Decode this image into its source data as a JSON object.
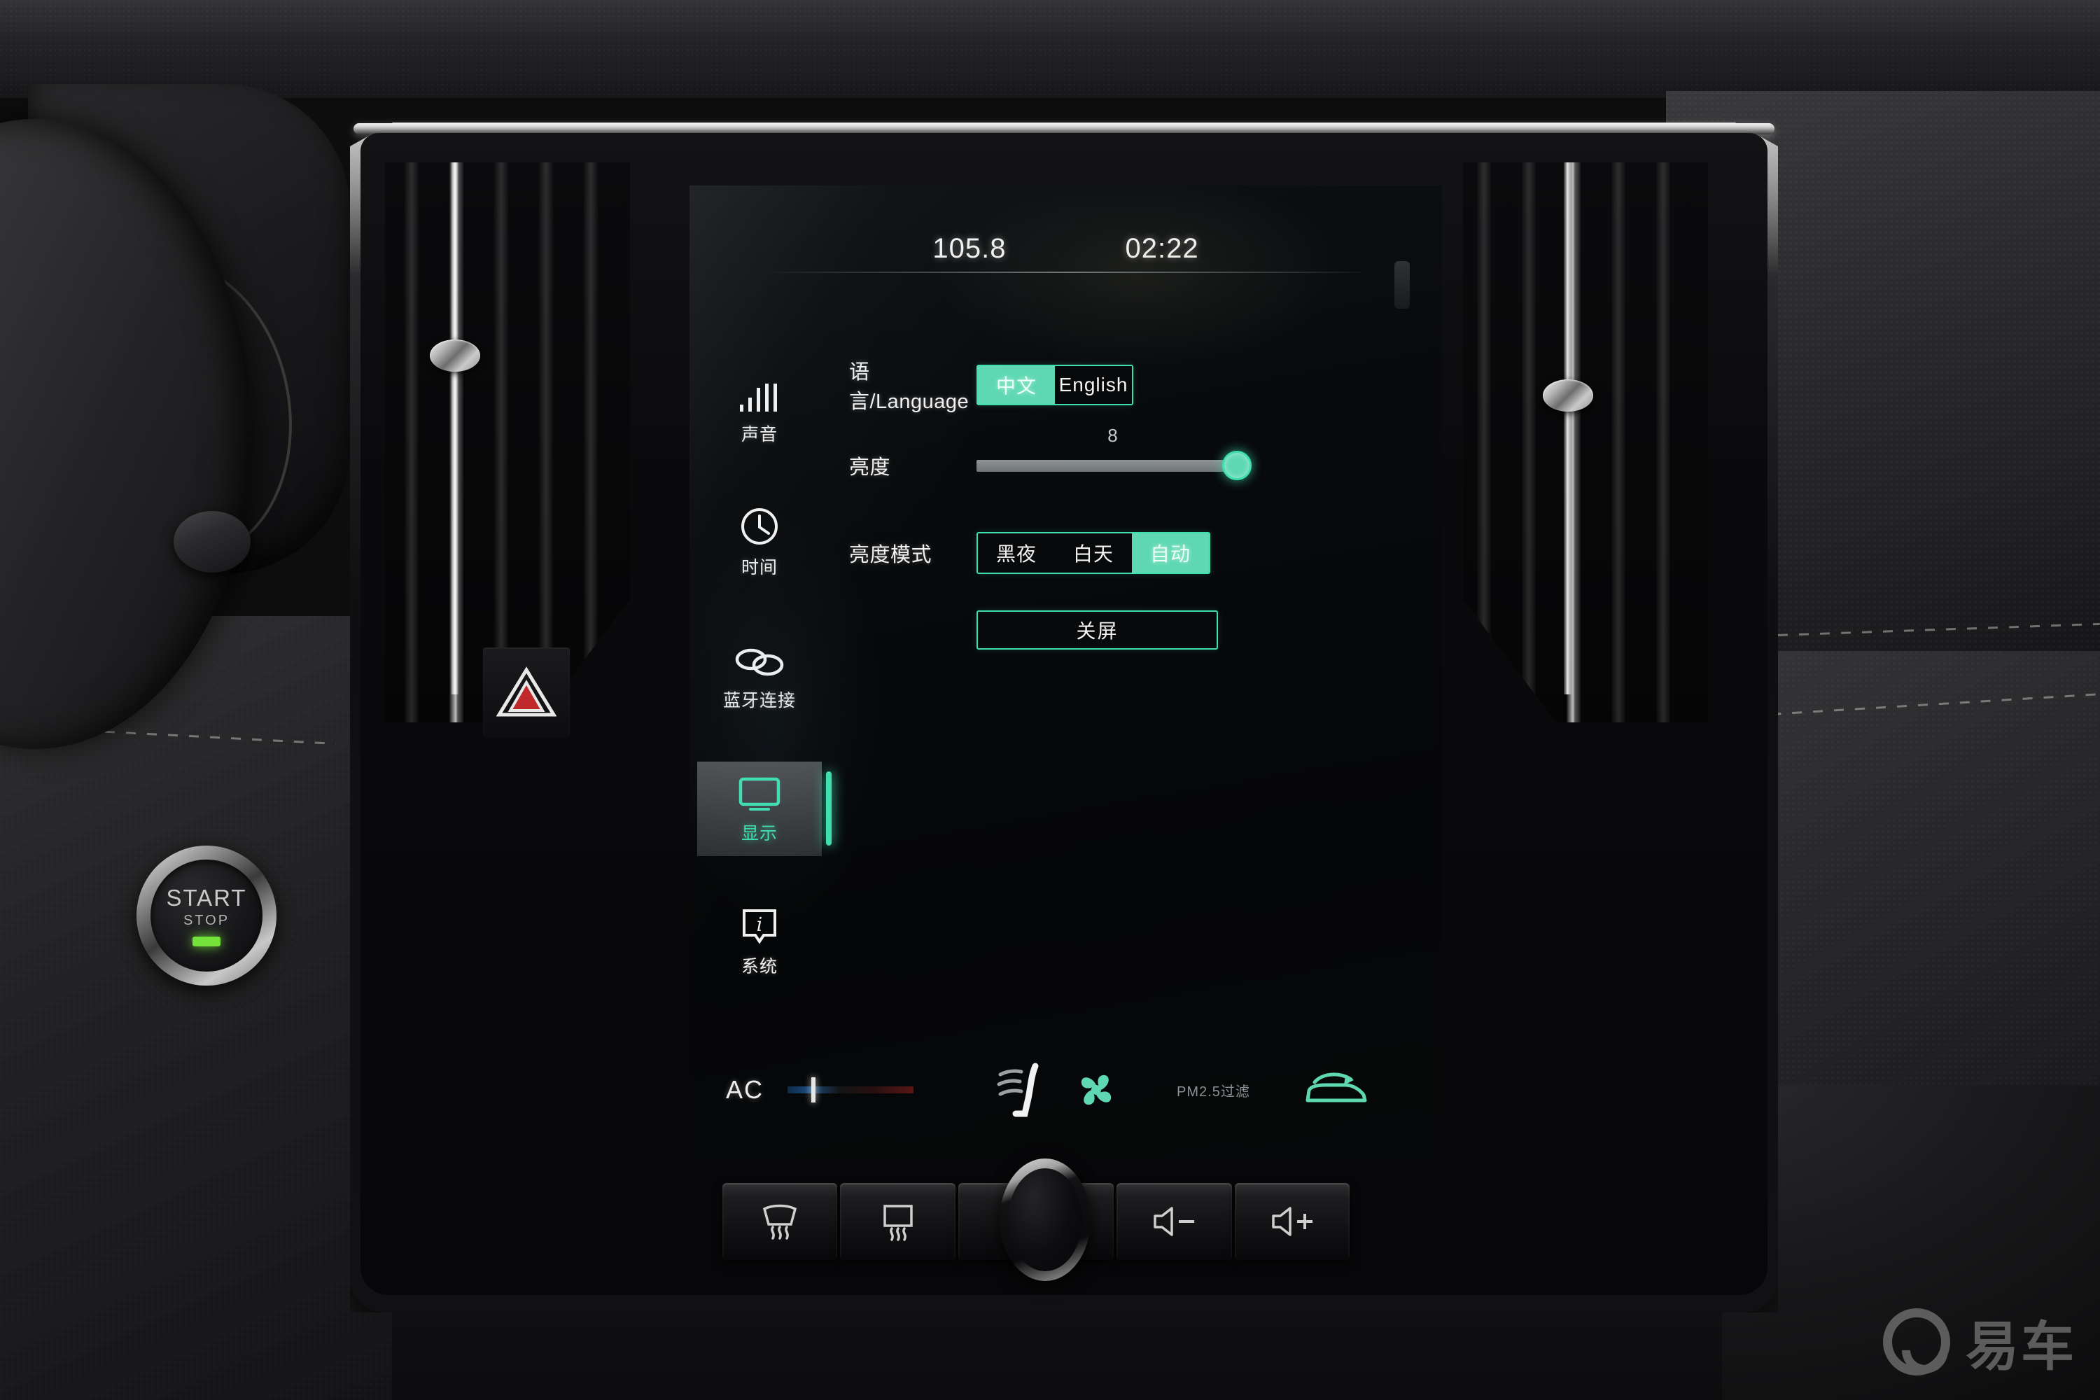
{
  "screen": {
    "statusbar": {
      "radio_frequency": "105.8",
      "clock": "02:22"
    },
    "sidebar": {
      "items": [
        {
          "label": "声音",
          "icon": "sound-bars-icon",
          "active": false
        },
        {
          "label": "时间",
          "icon": "clock-icon",
          "active": false
        },
        {
          "label": "蓝牙连接",
          "icon": "bluetooth-link-icon",
          "active": false
        },
        {
          "label": "显示",
          "icon": "monitor-icon",
          "active": true
        },
        {
          "label": "系统",
          "icon": "info-icon",
          "active": false
        }
      ]
    },
    "settings": {
      "language": {
        "label": "语言/Language",
        "options": [
          "中文",
          "English"
        ],
        "selected": "中文"
      },
      "brightness": {
        "label": "亮度",
        "value": "8",
        "min": 0,
        "max": 8,
        "percent": 100
      },
      "brightness_mode": {
        "label": "亮度模式",
        "options": [
          "黑夜",
          "白天",
          "自动"
        ],
        "selected": "自动"
      },
      "screen_off_button": "关屏"
    },
    "climate": {
      "ac_label": "AC",
      "pm_label": "PM2.5过滤",
      "icons": [
        "seat-airflow-icon",
        "fan-icon",
        "recirculation-car-icon"
      ]
    }
  },
  "hardware": {
    "start_stop": {
      "start": "START",
      "stop": "STOP"
    },
    "hard_keys": [
      {
        "name": "front-defrost",
        "icon": "windshield-defrost-icon"
      },
      {
        "name": "rear-defrost",
        "icon": "rear-defrost-icon"
      },
      {
        "name": "volume-down",
        "icon": "speaker-minus-icon"
      },
      {
        "name": "volume-up",
        "icon": "speaker-plus-icon"
      }
    ],
    "hazard_button": "hazard-triangle-icon"
  },
  "watermark": {
    "text": "易车"
  },
  "colors": {
    "accent": "#5fd8b2",
    "accent_bright": "#3fe0b0",
    "screen_bg": "#07090a",
    "text": "#f2f2f2",
    "hazard_red": "#d43030",
    "led_green": "#74e23a"
  }
}
